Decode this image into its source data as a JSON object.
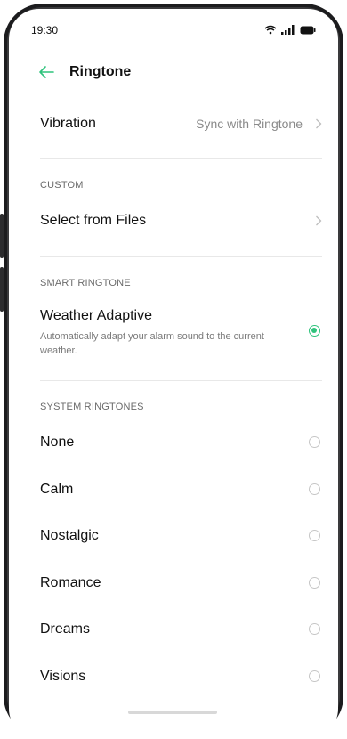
{
  "status_bar": {
    "time": "19:30"
  },
  "header": {
    "title": "Ringtone"
  },
  "vibration": {
    "label": "Vibration",
    "value": "Sync with Ringtone"
  },
  "custom": {
    "section": "CUSTOM",
    "item": "Select from Files"
  },
  "smart": {
    "section": "SMART RINGTONE",
    "title": "Weather Adaptive",
    "description": "Automatically adapt your alarm sound to the current weather.",
    "selected": true
  },
  "system": {
    "section": "SYSTEM RINGTONES",
    "items": [
      {
        "label": "None",
        "selected": false
      },
      {
        "label": "Calm",
        "selected": false
      },
      {
        "label": "Nostalgic",
        "selected": false
      },
      {
        "label": "Romance",
        "selected": false
      },
      {
        "label": "Dreams",
        "selected": false
      },
      {
        "label": "Visions",
        "selected": false
      }
    ]
  },
  "colors": {
    "accent": "#2fc37c",
    "divider": "#e8e8e8"
  }
}
